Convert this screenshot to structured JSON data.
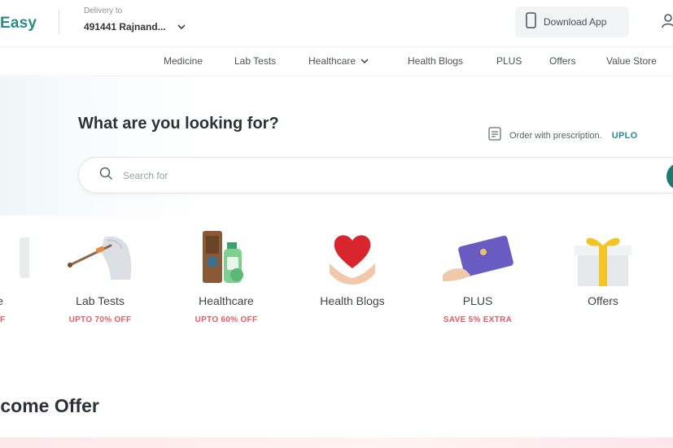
{
  "header": {
    "logo_text": "Easy",
    "delivery_label": "Delivery to",
    "delivery_value": "491441 Rajnand...",
    "download_label": "Download App"
  },
  "nav": {
    "items": [
      {
        "label": "Medicine"
      },
      {
        "label": "Lab Tests"
      },
      {
        "label": "Healthcare"
      },
      {
        "label": "Health Blogs"
      },
      {
        "label": "PLUS"
      },
      {
        "label": "Offers"
      },
      {
        "label": "Value Store"
      }
    ]
  },
  "hero": {
    "title": "What are you looking for?",
    "prescription_text": "Order with prescription.",
    "upload_label": "UPLO"
  },
  "search": {
    "placeholder": "Search for"
  },
  "categories": [
    {
      "label": "e",
      "sub": "FF"
    },
    {
      "label": "Lab Tests",
      "sub": "UPTO 70% OFF"
    },
    {
      "label": "Healthcare",
      "sub": "UPTO 60% OFF"
    },
    {
      "label": "Health Blogs",
      "sub": ""
    },
    {
      "label": "PLUS",
      "sub": "SAVE 5% EXTRA"
    },
    {
      "label": "Offers",
      "sub": ""
    }
  ],
  "welcome": {
    "title": "lcome Offer"
  },
  "colors": {
    "brand_teal": "#2b8a86",
    "discount_red": "#e25b6a",
    "search_button": "#1b7a72"
  }
}
